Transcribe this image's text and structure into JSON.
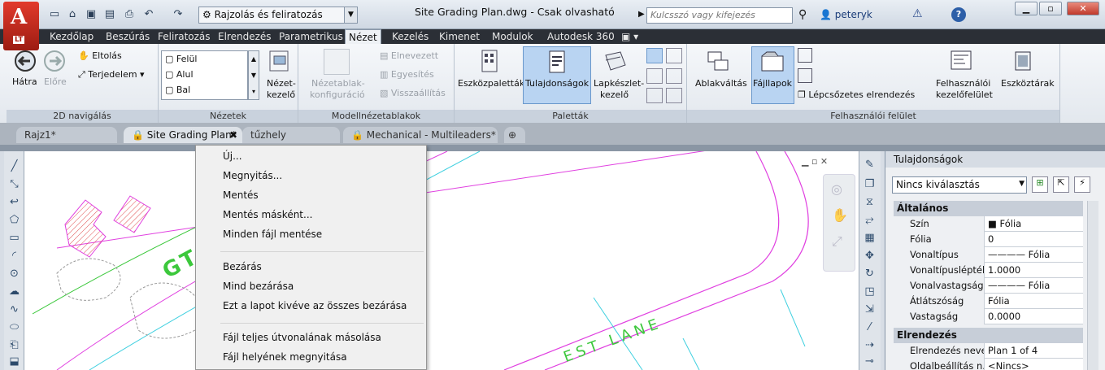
{
  "title": {
    "workspace": "Rajzolás és feliratozás",
    "document": "Site Grading Plan.dwg - Csak olvasható",
    "search_placeholder": "Kulcsszó vagy kifejezés",
    "user": "peteryk",
    "logo_text": "LT"
  },
  "ribbon_tabs": [
    "Kezdőlap",
    "Beszúrás",
    "Feliratozás",
    "Elrendezés",
    "Parametrikus",
    "Nézet",
    "Kezelés",
    "Kimenet",
    "Modulok",
    "Autodesk 360"
  ],
  "active_tab": "Nézet",
  "panels": {
    "nav": {
      "title": "2D navigálás",
      "back": "Hátra",
      "forward": "Előre",
      "pan": "Eltolás",
      "extents": "Terjedelem"
    },
    "views": {
      "title": "Nézetek",
      "items": [
        "Felül",
        "Alul",
        "Bal"
      ],
      "manager": "Nézet-",
      "manager2": "kezelő"
    },
    "viewports": {
      "title": "Modellnézetablakok",
      "config": "Nézetablak-",
      "config2": "konfiguráció",
      "named": "Elnevezett",
      "join": "Egyesítés",
      "restore": "Visszaállítás"
    },
    "palettes": {
      "title": "Paletták",
      "tool": "Eszközpaletták",
      "props": "Tulajdonságok",
      "sheetset": "Lapkészlet-",
      "sheetset2": "kezelő"
    },
    "ui": {
      "title": "Felhasználói felület",
      "switch": "Ablakváltás",
      "filetabs": "Fájllapok",
      "cascade": "Lépcsőzetes elrendezés",
      "uimanager": "Felhasználói",
      "uimanager2": "kezelőfelület",
      "toolbars": "Eszköztárak"
    }
  },
  "doc_tabs": [
    "Rajz1*",
    "Site Grading Plan*",
    "tűzhely",
    "Mechanical - Multileaders*"
  ],
  "menu": {
    "items": [
      "Új...",
      "Megnyitás...",
      "Mentés",
      "Mentés másként...",
      "Minden fájl mentése",
      "Bezárás",
      "Mind bezárása",
      "Ezt a lapot kivéve az összes bezárása",
      "Fájl teljes útvonalának másolása",
      "Fájl helyének megnyitása"
    ]
  },
  "properties": {
    "title": "Tulajdonságok",
    "selection": "Nincs kiválasztás",
    "general": "Általános",
    "rows": [
      {
        "k": "Szín",
        "v": "■ Fólia"
      },
      {
        "k": "Fólia",
        "v": "0"
      },
      {
        "k": "Vonaltípus",
        "v": "———— Fólia"
      },
      {
        "k": "Vonaltípuslépték",
        "v": "1.0000"
      },
      {
        "k": "Vonalvastagság",
        "v": "———— Fólia"
      },
      {
        "k": "Átlátszóság",
        "v": "Fólia"
      },
      {
        "k": "Vastagság",
        "v": "0.0000"
      }
    ],
    "layout": "Elrendezés",
    "rows2": [
      {
        "k": "Elrendezés neve",
        "v": "Plan 1 of 4"
      },
      {
        "k": "Oldalbeállítás n...",
        "v": "<Nincs>"
      }
    ]
  },
  "drawing_text": {
    "street1": "GTR",
    "street2": "EST LANE"
  },
  "colors": {
    "accent": "#b9d4f2",
    "magenta": "#e040e0",
    "cyan": "#40d0e0",
    "green": "#3cc83c"
  }
}
